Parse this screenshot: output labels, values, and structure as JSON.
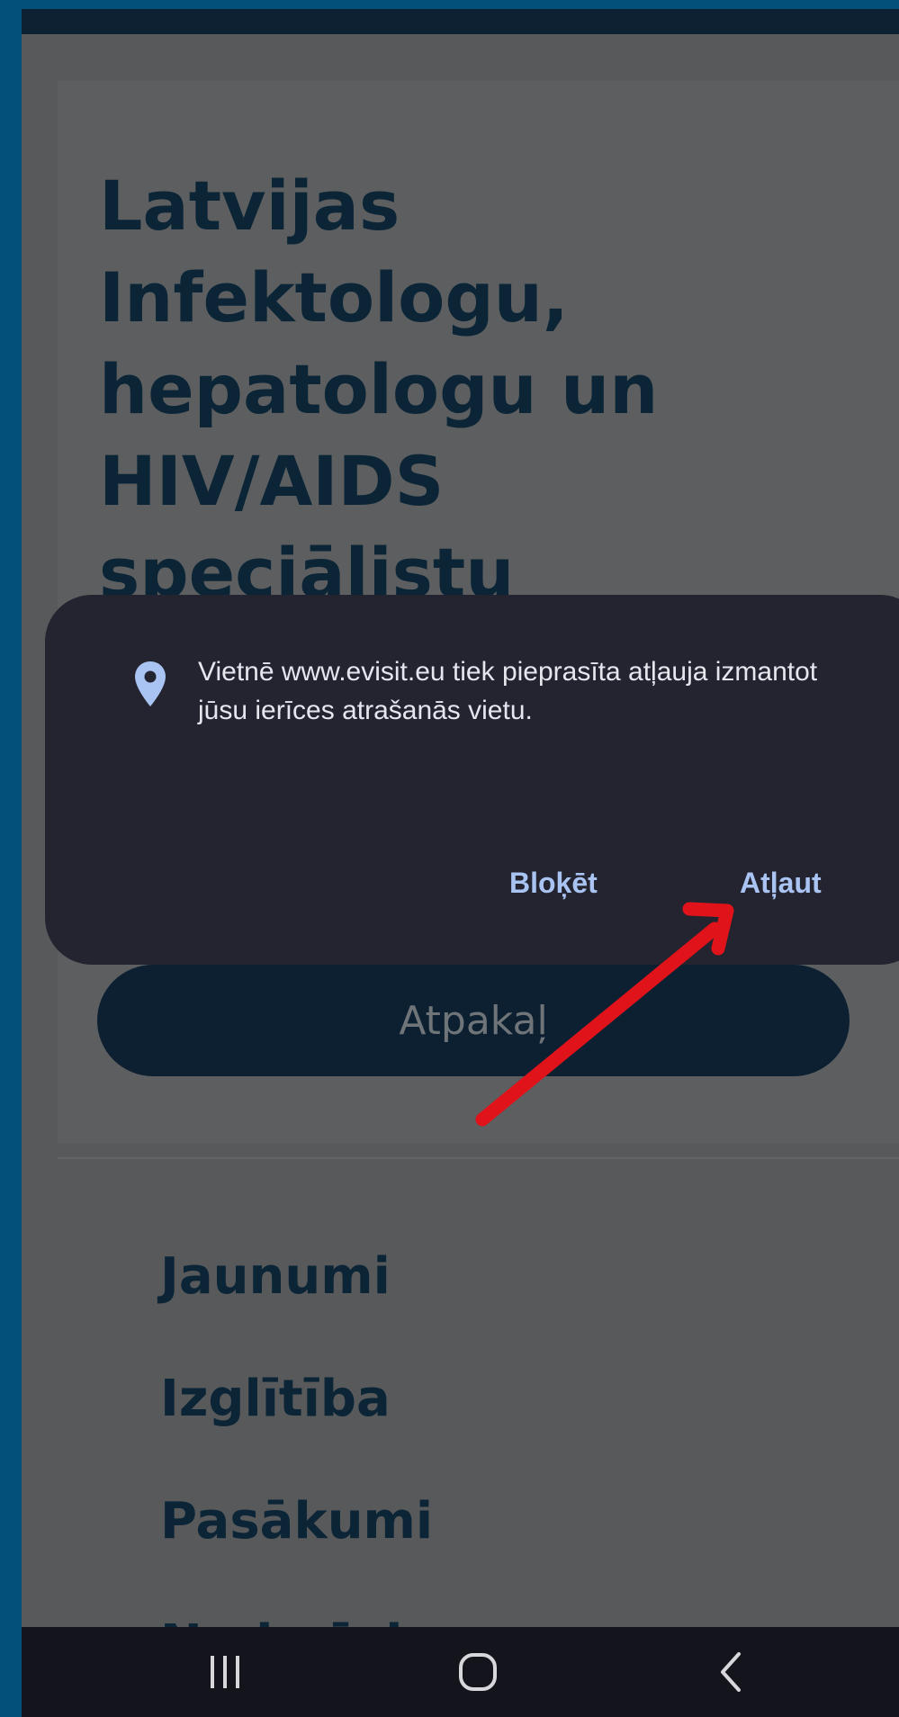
{
  "website": {
    "title": "Latvijas\nInfektologu,\nhepatologu un\nHIV/AIDS\nspeciālistu",
    "back_button_label": "Atpakaļ",
    "menu": [
      {
        "label": "Jaunumi"
      },
      {
        "label": "Izglītība"
      },
      {
        "label": "Pasākumi"
      },
      {
        "label": "Noderīgi"
      }
    ]
  },
  "permission_dialog": {
    "icon": "location-pin-icon",
    "message": "Vietnē www.evisit.eu tiek pieprasīta atļauja izmantot jūsu ierīces atrašanās vietu.",
    "block_label": "Bloķēt",
    "allow_label": "Atļaut"
  },
  "annotation": {
    "icon": "arrow-icon",
    "color": "#e0131a"
  },
  "navigation_bar": {
    "buttons": [
      {
        "icon": "recents-icon"
      },
      {
        "icon": "home-icon"
      },
      {
        "icon": "back-icon"
      }
    ]
  },
  "colors": {
    "outer_frame": "#03507a",
    "dim_page": "#58595b",
    "dialog_bg": "#23242f",
    "dialog_accent": "#a9c3f3",
    "title_text": "#0b2536"
  }
}
